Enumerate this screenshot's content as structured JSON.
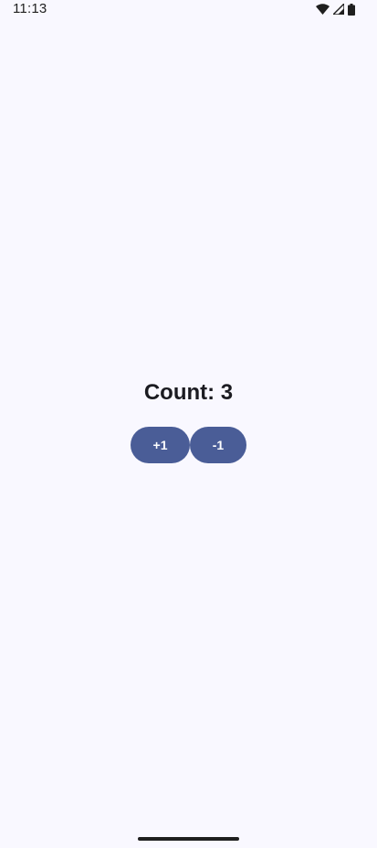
{
  "status_bar": {
    "time": "11:13",
    "icons": [
      "wifi-icon",
      "signal-icon",
      "battery-icon"
    ]
  },
  "counter": {
    "text": "Count: 3"
  },
  "buttons": {
    "increment_label": "+1",
    "decrement_label": "-1"
  },
  "colors": {
    "background": "#f9f8ff",
    "button": "#4a5d97",
    "button_text": "#ffffff",
    "text": "#1b1b21"
  }
}
